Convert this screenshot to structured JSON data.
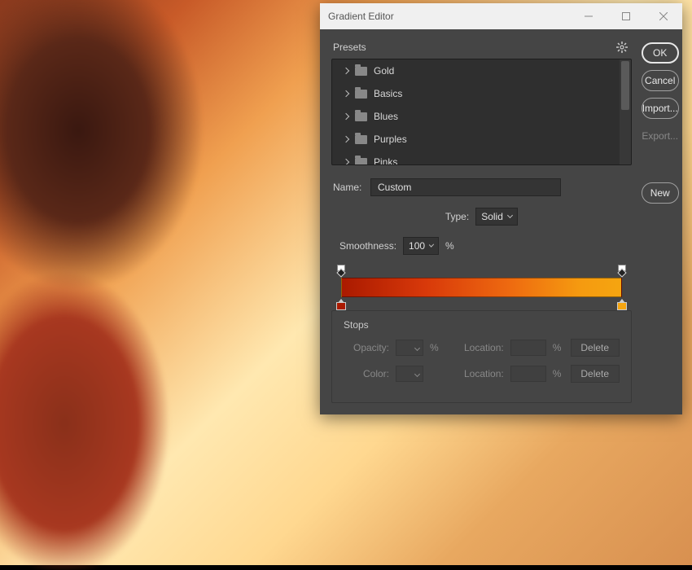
{
  "dialog": {
    "title": "Gradient Editor",
    "buttons": {
      "ok": "OK",
      "cancel": "Cancel",
      "import": "Import...",
      "export": "Export...",
      "new": "New"
    }
  },
  "presets": {
    "label": "Presets",
    "items": [
      "Gold",
      "Basics",
      "Blues",
      "Purples",
      "Pinks"
    ]
  },
  "name": {
    "label": "Name:",
    "value": "Custom"
  },
  "type": {
    "label": "Type:",
    "value": "Solid"
  },
  "smoothness": {
    "label": "Smoothness:",
    "value": "100",
    "unit": "%"
  },
  "gradient": {
    "start_color": "#aa1a00",
    "end_color": "#f5a510"
  },
  "stops": {
    "label": "Stops",
    "opacity_label": "Opacity:",
    "color_label": "Color:",
    "location_label": "Location:",
    "unit": "%",
    "delete": "Delete"
  }
}
